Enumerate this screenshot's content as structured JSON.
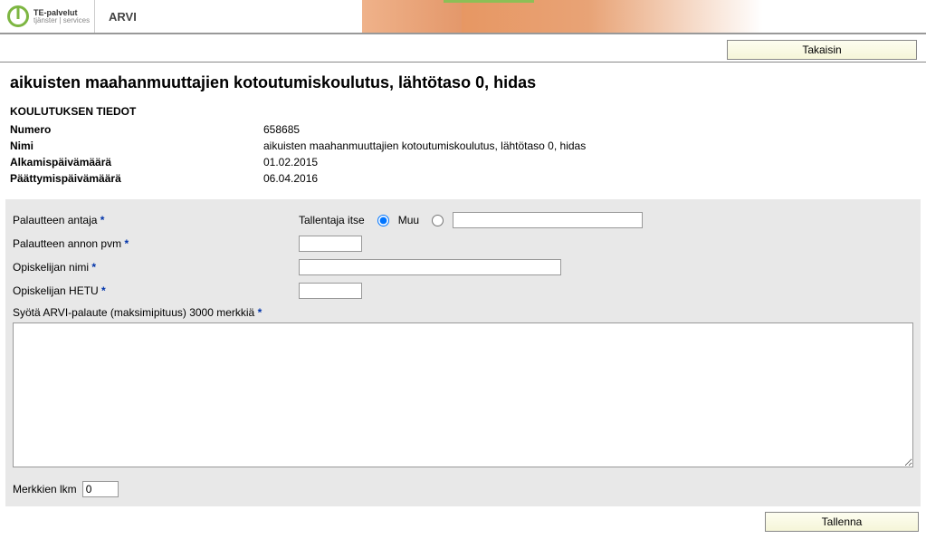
{
  "header": {
    "logo_line1": "TE-palvelut",
    "logo_line2": "tjänster | services",
    "app_title": "ARVI"
  },
  "nav": {
    "back_label": "Takaisin"
  },
  "page_title": "aikuisten maahanmuuttajien kotoutumiskoulutus, lähtötaso 0, hidas",
  "info": {
    "heading": "KOULUTUKSEN TIEDOT",
    "rows": [
      {
        "label": "Numero",
        "value": "658685"
      },
      {
        "label": "Nimi",
        "value": "aikuisten maahanmuuttajien kotoutumiskoulutus, lähtötaso 0, hidas"
      },
      {
        "label": "Alkamispäivämäärä",
        "value": "01.02.2015"
      },
      {
        "label": "Päättymispäivämäärä",
        "value": "06.04.2016"
      }
    ]
  },
  "form": {
    "giver_label": "Palautteen antaja",
    "saver_label": "Tallentaja itse",
    "other_label": "Muu",
    "other_value": "",
    "date_label": "Palautteen annon pvm",
    "date_value": "",
    "student_name_label": "Opiskelijan nimi",
    "student_name_value": "",
    "student_hetu_label": "Opiskelijan HETU",
    "student_hetu_value": "",
    "feedback_label": "Syötä ARVI-palaute (maksimipituus) 3000 merkkiä",
    "feedback_value": "",
    "counter_label": "Merkkien lkm",
    "counter_value": "0",
    "save_label": "Tallenna",
    "required_marker": "*"
  }
}
